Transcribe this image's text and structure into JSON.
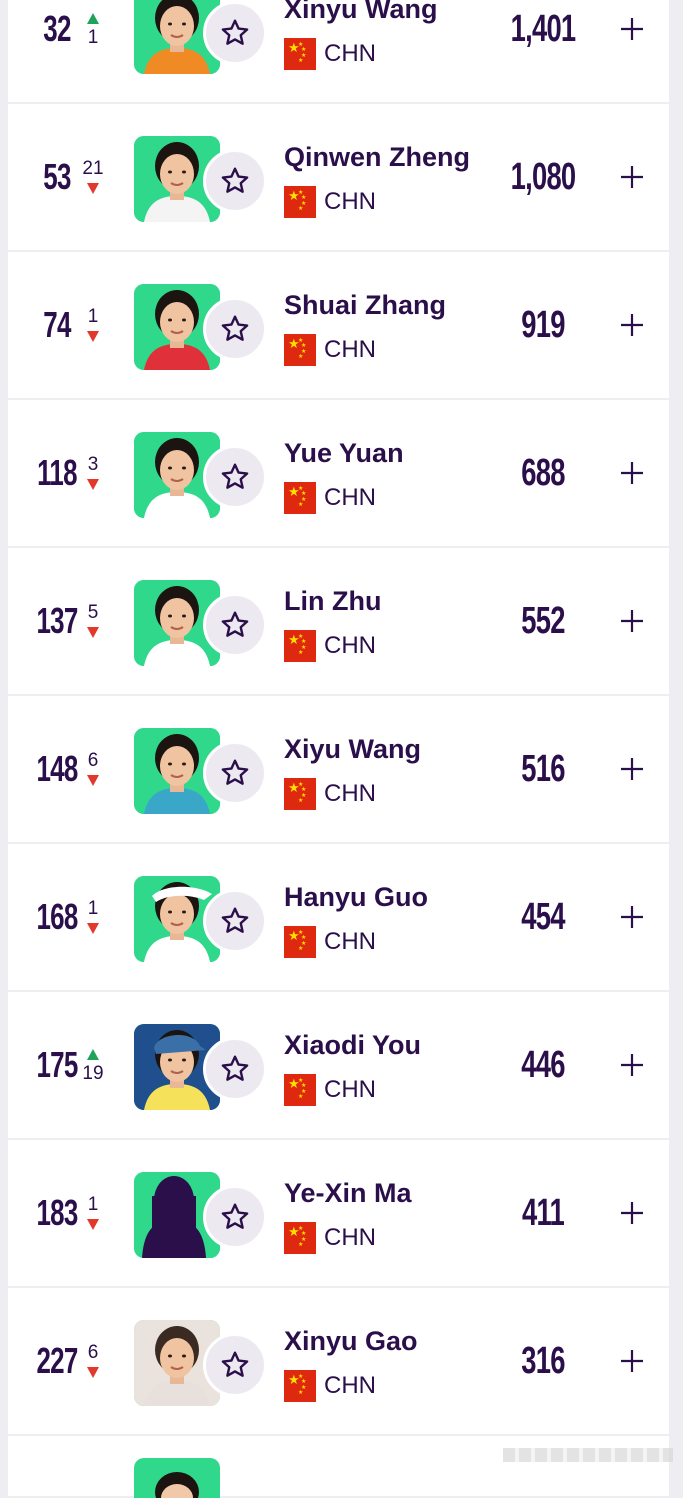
{
  "rows": [
    {
      "rank": "32",
      "move": "1",
      "dir": "up",
      "name": "Xinyu Wang",
      "country": "CHN",
      "points": "1,401",
      "photo": "green",
      "hair": "#1b1410",
      "shirt": "#f08a24"
    },
    {
      "rank": "53",
      "move": "21",
      "dir": "down",
      "name": "Qinwen Zheng",
      "country": "CHN",
      "points": "1,080",
      "photo": "green",
      "hair": "#1b1410",
      "shirt": "#f4f4f4"
    },
    {
      "rank": "74",
      "move": "1",
      "dir": "down",
      "name": "Shuai Zhang",
      "country": "CHN",
      "points": "919",
      "photo": "green",
      "hair": "#1b1410",
      "shirt": "#e0303a"
    },
    {
      "rank": "118",
      "move": "3",
      "dir": "down",
      "name": "Yue Yuan",
      "country": "CHN",
      "points": "688",
      "photo": "green",
      "hair": "#1b1410",
      "shirt": "#ffffff"
    },
    {
      "rank": "137",
      "move": "5",
      "dir": "down",
      "name": "Lin Zhu",
      "country": "CHN",
      "points": "552",
      "photo": "green",
      "hair": "#1b1410",
      "shirt": "#ffffff"
    },
    {
      "rank": "148",
      "move": "6",
      "dir": "down",
      "name": "Xiyu Wang",
      "country": "CHN",
      "points": "516",
      "photo": "green",
      "hair": "#1b1410",
      "shirt": "#3aa7c8"
    },
    {
      "rank": "168",
      "move": "1",
      "dir": "down",
      "name": "Hanyu Guo",
      "country": "CHN",
      "points": "454",
      "photo": "green",
      "hair": "#1b1410",
      "shirt": "#ffffff"
    },
    {
      "rank": "175",
      "move": "19",
      "dir": "up",
      "name": "Xiaodi You",
      "country": "CHN",
      "points": "446",
      "photo": "blue",
      "hair": "#1b1410",
      "shirt": "#f5e25a"
    },
    {
      "rank": "183",
      "move": "1",
      "dir": "down",
      "name": "Ye-Xin Ma",
      "country": "CHN",
      "points": "411",
      "photo": "silhouette",
      "hair": "#2a0f4a",
      "shirt": "#2a0f4a"
    },
    {
      "rank": "227",
      "move": "6",
      "dir": "down",
      "name": "Xinyu Gao",
      "country": "CHN",
      "points": "316",
      "photo": "portrait",
      "hair": "#3a2a22",
      "shirt": "#e8e0dc"
    }
  ],
  "colors": {
    "accent": "#2a0f4a",
    "photo_bg": "#2fd88a",
    "up": "#1fa35a",
    "down": "#e2392b",
    "flag": "#de2910"
  }
}
